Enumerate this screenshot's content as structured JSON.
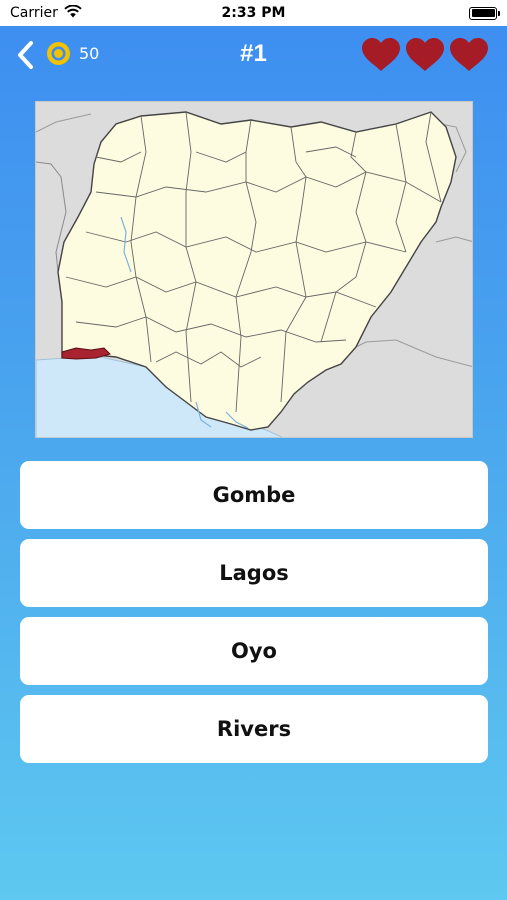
{
  "status_bar": {
    "carrier": "Carrier",
    "time": "2:33 PM"
  },
  "header": {
    "coins": "50",
    "level": "#1",
    "lives": 3
  },
  "map": {
    "highlighted_region": "Lagos",
    "colors": {
      "land": "#fdfbe0",
      "neighbor": "#dcdcdc",
      "water": "#cfe8f9",
      "highlight": "#a8232f",
      "border": "#555555"
    }
  },
  "answers": [
    {
      "label": "Gombe"
    },
    {
      "label": "Lagos"
    },
    {
      "label": "Oyo"
    },
    {
      "label": "Rivers"
    }
  ],
  "colors": {
    "gradient_top": "#3d8df0",
    "gradient_bottom": "#5ec8f0",
    "heart": "#a51c26",
    "coin": "#f2c200"
  }
}
